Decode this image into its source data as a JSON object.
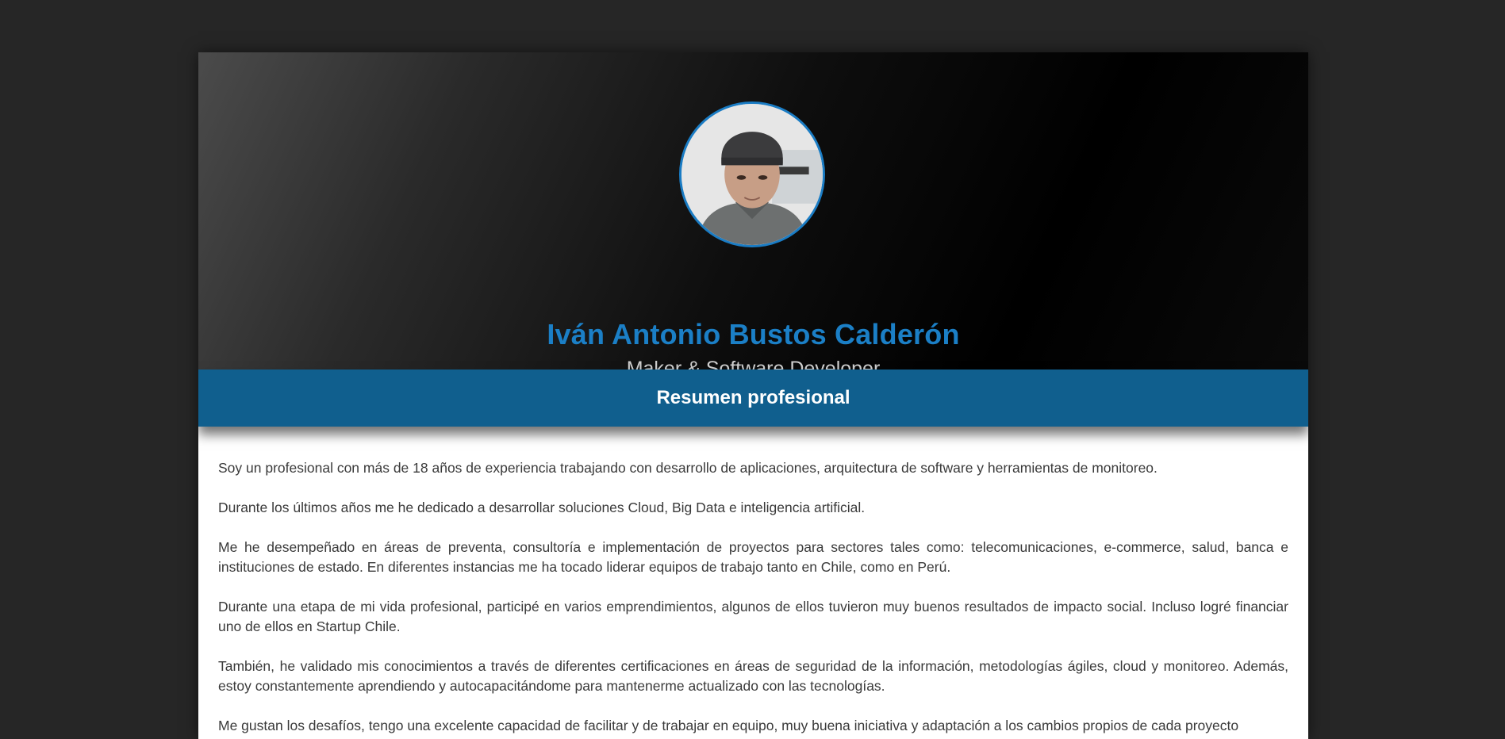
{
  "profile": {
    "name": "Iván Antonio Bustos Calderón",
    "role": "Maker & Software Developer"
  },
  "summary": {
    "title": "Resumen profesional",
    "paragraphs": [
      "Soy un profesional con más de 18 años de experiencia trabajando con desarrollo de aplicaciones, arquitectura de software y herramientas de monitoreo.",
      "Durante los últimos años me he dedicado a desarrollar soluciones Cloud, Big Data e inteligencia artificial.",
      "Me he desempeñado en áreas de preventa, consultoría e implementación de proyectos para sectores tales como: telecomunicaciones, e-commerce, salud, banca e instituciones de estado. En diferentes instancias me ha tocado liderar equipos de trabajo tanto en Chile, como en Perú.",
      "Durante una etapa de mi vida profesional, participé en varios emprendimientos, algunos de ellos tuvieron muy buenos resultados de impacto social. Incluso logré financiar uno de ellos en Startup Chile.",
      "También, he validado mis conocimientos a través de diferentes certificaciones en áreas de seguridad de la información, metodologías ágiles, cloud y monitoreo. Además, estoy constantemente aprendiendo y autocapacitándome para mantenerme actualizado con las tecnologías.",
      "Me gustan los desafíos, tengo una excelente capacidad de facilitar y de trabajar en equipo, muy buena iniciativa y adaptación a los cambios propios de cada proyecto"
    ]
  },
  "colors": {
    "accent": "#1b7fc6",
    "section_bar": "#105f8e",
    "background": "#262626"
  }
}
